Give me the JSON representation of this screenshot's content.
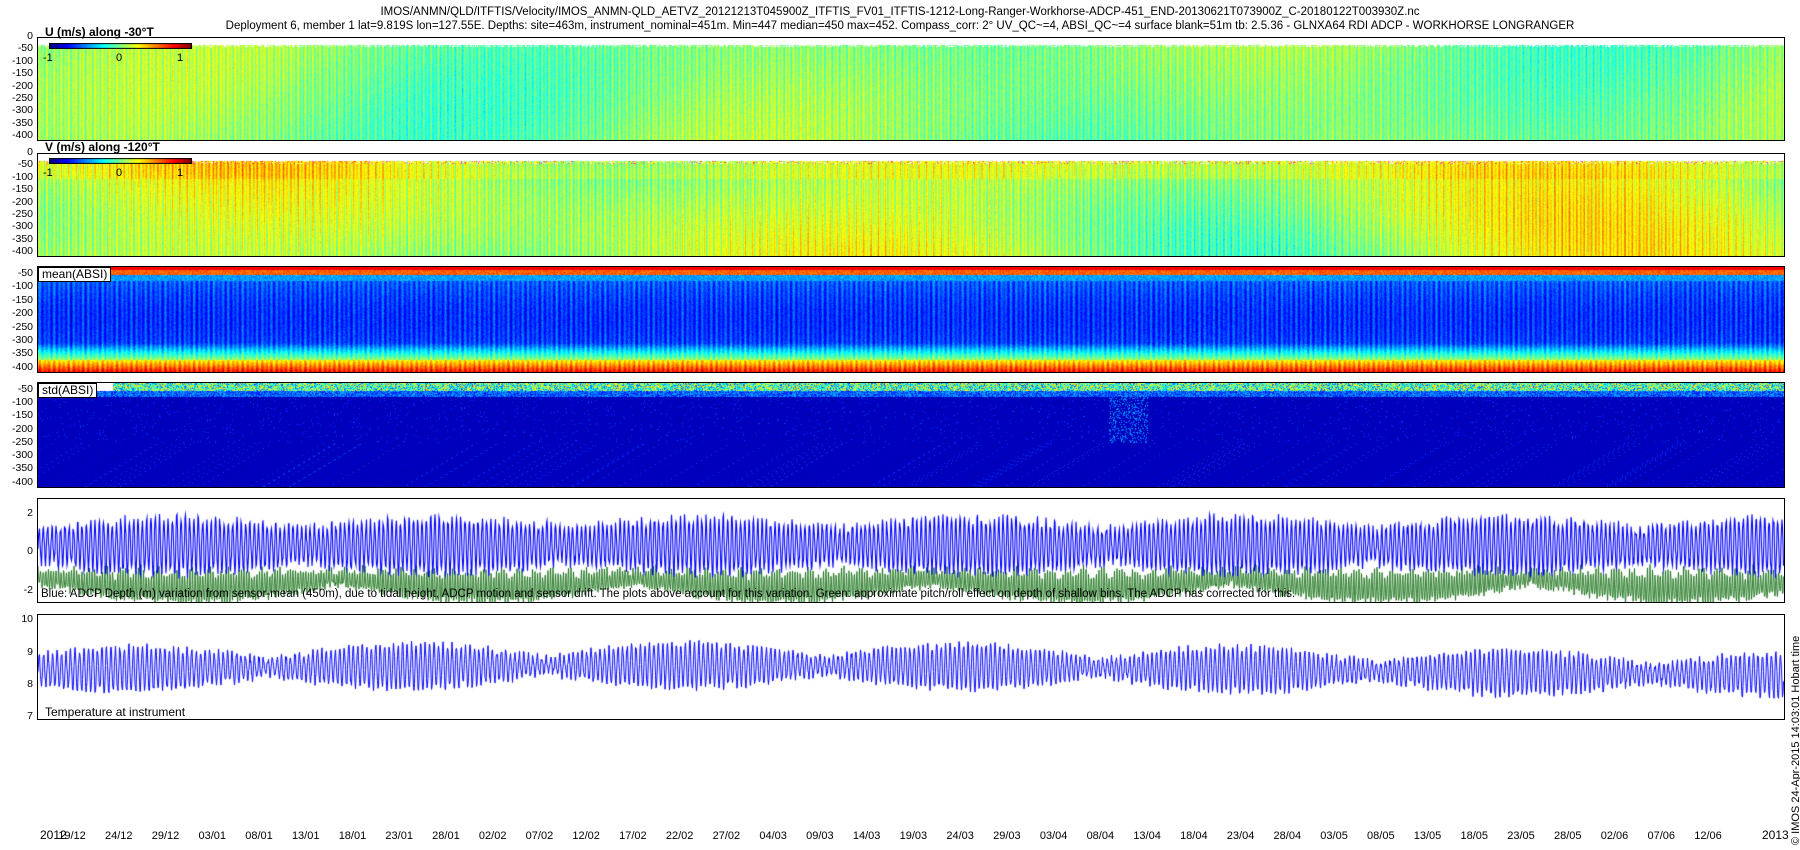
{
  "header": {
    "title_line1": "IMOS/ANMN/QLD/ITFTIS/Velocity/IMOS_ANMN-QLD_AETVZ_20121213T045900Z_ITFTIS_FV01_ITFTIS-1212-Long-Ranger-Workhorse-ADCP-451_END-20130621T073900Z_C-20180122T003930Z.nc",
    "title_line2": "Deployment 6, member 1 lat=9.819S lon=127.55E. Depths: site=463m, instrument_nominal=451m. Min=447 median=450 max=452. Compass_corr: 2° UV_QC~=4, ABSI_QC~=4 surface blank=51m tb: 2.5.36 - GLNXA64 RDI ADCP - WORKHORSE LONGRANGER"
  },
  "colors": {
    "blue_series": "#0000ff",
    "green_series": "#006400",
    "frame": "#000000"
  },
  "chart_data": [
    {
      "type": "heatmap",
      "panel_label": "U (m/s) along -30°T",
      "yticks": [
        "0",
        "-50",
        "-100",
        "-150",
        "-200",
        "-250",
        "-300",
        "-350",
        "-400"
      ],
      "ylim": [
        -420,
        0
      ],
      "colormap": "jet",
      "colorbar_ticks": [
        "-1",
        "0",
        "1"
      ],
      "clim": [
        -1.2,
        1.2
      ],
      "dominant_value": 0.0
    },
    {
      "type": "heatmap",
      "panel_label": "V (m/s) along -120°T",
      "yticks": [
        "0",
        "-50",
        "-100",
        "-150",
        "-200",
        "-250",
        "-300",
        "-350",
        "-400"
      ],
      "ylim": [
        -420,
        0
      ],
      "colormap": "jet",
      "colorbar_ticks": [
        "-1",
        "0",
        "1"
      ],
      "clim": [
        -1.2,
        1.2
      ],
      "dominant_value": 0.1
    },
    {
      "type": "heatmap",
      "panel_label": "mean(ABSI)",
      "yticks": [
        "-50",
        "-100",
        "-150",
        "-200",
        "-250",
        "-300",
        "-350",
        "-400"
      ],
      "ylim": [
        -420,
        -20
      ],
      "colormap": "jet"
    },
    {
      "type": "heatmap",
      "panel_label": "std(ABSI)",
      "yticks": [
        "-50",
        "-100",
        "-150",
        "-200",
        "-250",
        "-300",
        "-350",
        "-400"
      ],
      "ylim": [
        -420,
        -20
      ],
      "colormap": "jet"
    },
    {
      "type": "line",
      "yticks": [
        "2",
        "0",
        "-2"
      ],
      "ylim": [
        -2.6,
        2.8
      ],
      "series": [],
      "series_color": [
        "#0000ff",
        "#006400"
      ],
      "note": "Blue: ADCP Depth (m) variation from sensor-mean (450m), due to tidal height, ADCP motion and sensor drift. The plots above account for this variation. Green: approximate pitch/roll effect on depth of shallow bins. The ADCP has corrected for this."
    },
    {
      "type": "line",
      "yticks": [
        "10",
        "9",
        "8",
        "7"
      ],
      "ylim": [
        6.9,
        10.2
      ],
      "series": [],
      "series_color": [
        "#0000ff"
      ],
      "note": "Temperature at instrument"
    }
  ],
  "x_axis": {
    "ticks": [
      "19/12",
      "24/12",
      "29/12",
      "03/01",
      "08/01",
      "13/01",
      "18/01",
      "23/01",
      "28/01",
      "02/02",
      "07/02",
      "12/02",
      "17/02",
      "22/02",
      "27/02",
      "04/03",
      "09/03",
      "14/03",
      "19/03",
      "24/03",
      "29/03",
      "03/04",
      "08/04",
      "13/04",
      "18/04",
      "23/04",
      "28/04",
      "03/05",
      "08/05",
      "13/05",
      "18/05",
      "23/05",
      "28/05",
      "02/06",
      "07/06",
      "12/06"
    ],
    "year_left": "2012",
    "year_right": "2013"
  },
  "credit": "© IMOS 24-Apr-2015 14:03:01 Hobart time"
}
